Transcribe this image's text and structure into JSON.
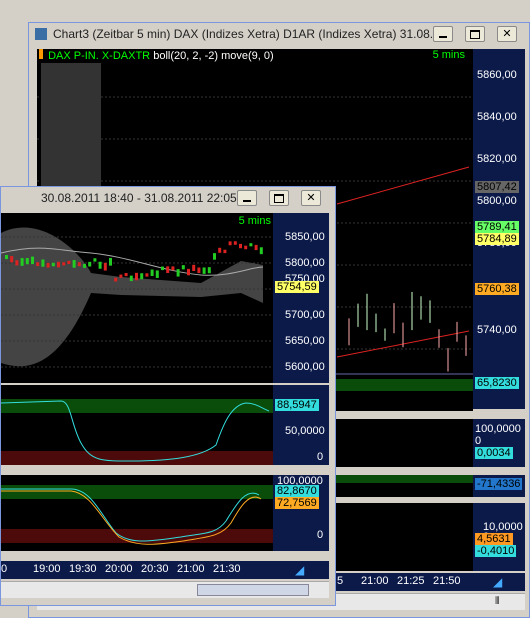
{
  "back_window": {
    "title": "Chart3 (Zeitbar 5 min)  DAX (Indizes Xetra) D1AR (Indizes Xetra) 31.08...",
    "header_left": "DAX P-IN.  X-DAXTR",
    "header_ind": "boll(20, 2, -2)  move(9, 0)",
    "header_right": "5 mins",
    "price_ticks": [
      "5860,00",
      "5840,00",
      "5820,00",
      "5800,00",
      "5780,00",
      "5760,00",
      "5740,00"
    ],
    "price_tags": {
      "gray": "5807,42",
      "green": "5789,41",
      "yellow": "5784,89",
      "orange": "5760,38"
    },
    "ind1_value": "65,8230",
    "ind2_ticks": [
      "100,0000",
      "0"
    ],
    "ind2_value": "0,0034",
    "ind3_value": "-71,4336",
    "ind4_ticks": [
      "10,0000",
      "0"
    ],
    "ind4_values": [
      "4,5631",
      "-0,4010"
    ],
    "time_labels": [
      "5",
      "21:00",
      "21:25",
      "21:50"
    ]
  },
  "front_window": {
    "title": "30.08.2011 18:40 - 31.08.2011 22:05",
    "header_right": "5 mins",
    "price_ticks": [
      "5850,00",
      "5800,00",
      "5750,00",
      "5700,00",
      "5650,00",
      "5600,00"
    ],
    "last_price": "5754,59",
    "ind1_ticks": [
      "50,0000",
      "0"
    ],
    "ind1_value": "88,5947",
    "ind2_ticks": [
      "100,0000",
      "0"
    ],
    "ind2_values": [
      "82,8670",
      "72,7569"
    ],
    "time_labels": [
      "0",
      "19:00",
      "19:30",
      "20:00",
      "20:30",
      "21:00",
      "21:30"
    ]
  },
  "colors": {
    "chart_bg": "#000000",
    "scale_bg": "#0c1a4a",
    "bull": "#22cc22",
    "bear": "#dd2222",
    "band": "#444444"
  }
}
